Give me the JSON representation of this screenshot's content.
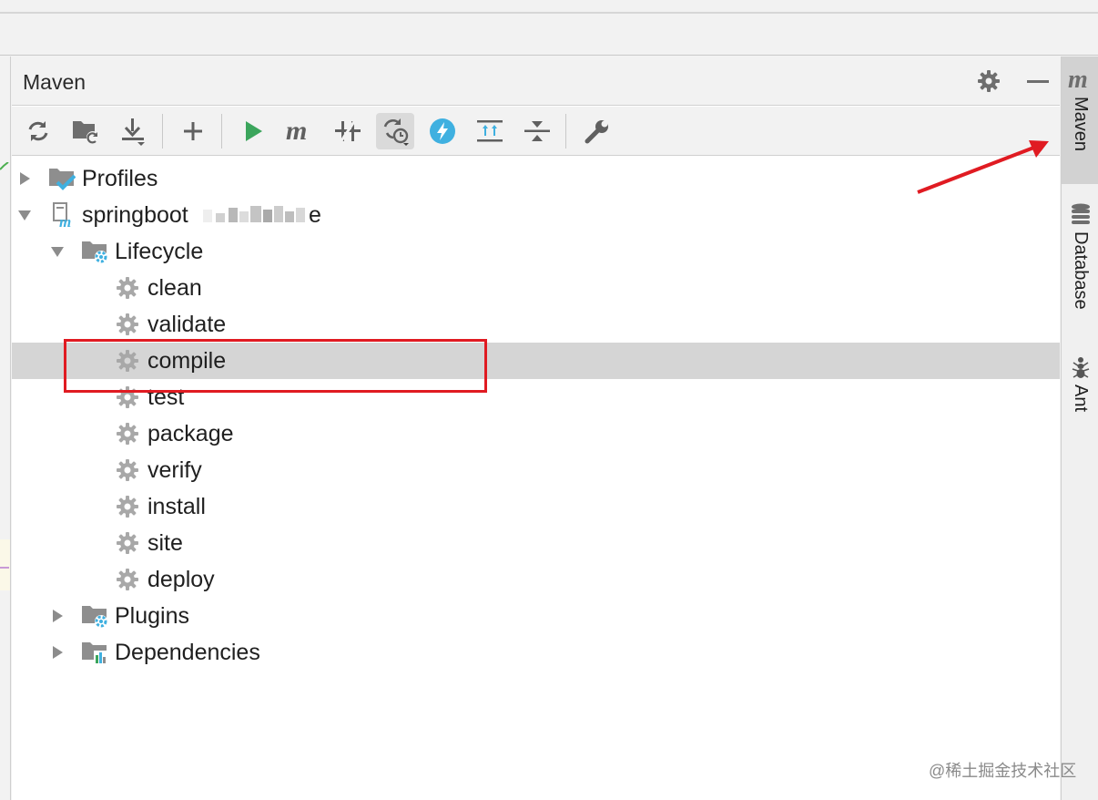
{
  "panel": {
    "title": "Maven"
  },
  "header": {
    "settings_icon": "gear-icon",
    "minimize_icon": "minimize-icon"
  },
  "toolbar": {
    "buttons": [
      {
        "name": "reload-all-projects-button",
        "icon": "refresh-icon"
      },
      {
        "name": "generate-sources-button",
        "icon": "folder-refresh-icon"
      },
      {
        "name": "download-sources-button",
        "icon": "download-icon"
      },
      {
        "name": "add-project-button",
        "icon": "plus-icon"
      },
      {
        "name": "run-goal-button",
        "icon": "run-triangle-icon"
      },
      {
        "name": "execute-maven-goal-button",
        "icon": "maven-m-icon"
      },
      {
        "name": "toggle-offline-mode-button",
        "icon": "offline-icon"
      },
      {
        "name": "skip-tests-button",
        "icon": "skip-tests-icon",
        "active": true
      },
      {
        "name": "show-dependencies-button",
        "icon": "lightning-icon"
      },
      {
        "name": "expand-all-button",
        "icon": "expand-all-icon"
      },
      {
        "name": "collapse-all-button",
        "icon": "collapse-all-icon"
      },
      {
        "name": "maven-settings-button",
        "icon": "wrench-icon"
      }
    ]
  },
  "tree": {
    "profiles": "Profiles",
    "project": "springboot",
    "project_suffix": "e",
    "lifecycle": "Lifecycle",
    "phases": [
      "clean",
      "validate",
      "compile",
      "test",
      "package",
      "verify",
      "install",
      "site",
      "deploy"
    ],
    "selected_phase": "compile",
    "plugins": "Plugins",
    "dependencies": "Dependencies"
  },
  "side_stripe": {
    "items": [
      {
        "label": "Maven",
        "icon": "maven-m-icon",
        "active": true
      },
      {
        "label": "Database",
        "icon": "database-icon",
        "active": false
      },
      {
        "label": "Ant",
        "icon": "ant-icon",
        "active": false
      }
    ]
  },
  "watermark": "@稀土掘金技术社区",
  "colors": {
    "accent_blue": "#3fb0e0",
    "run_green": "#3ba55c",
    "annotation_red": "#e01b22",
    "selection": "#d5d5d5"
  }
}
